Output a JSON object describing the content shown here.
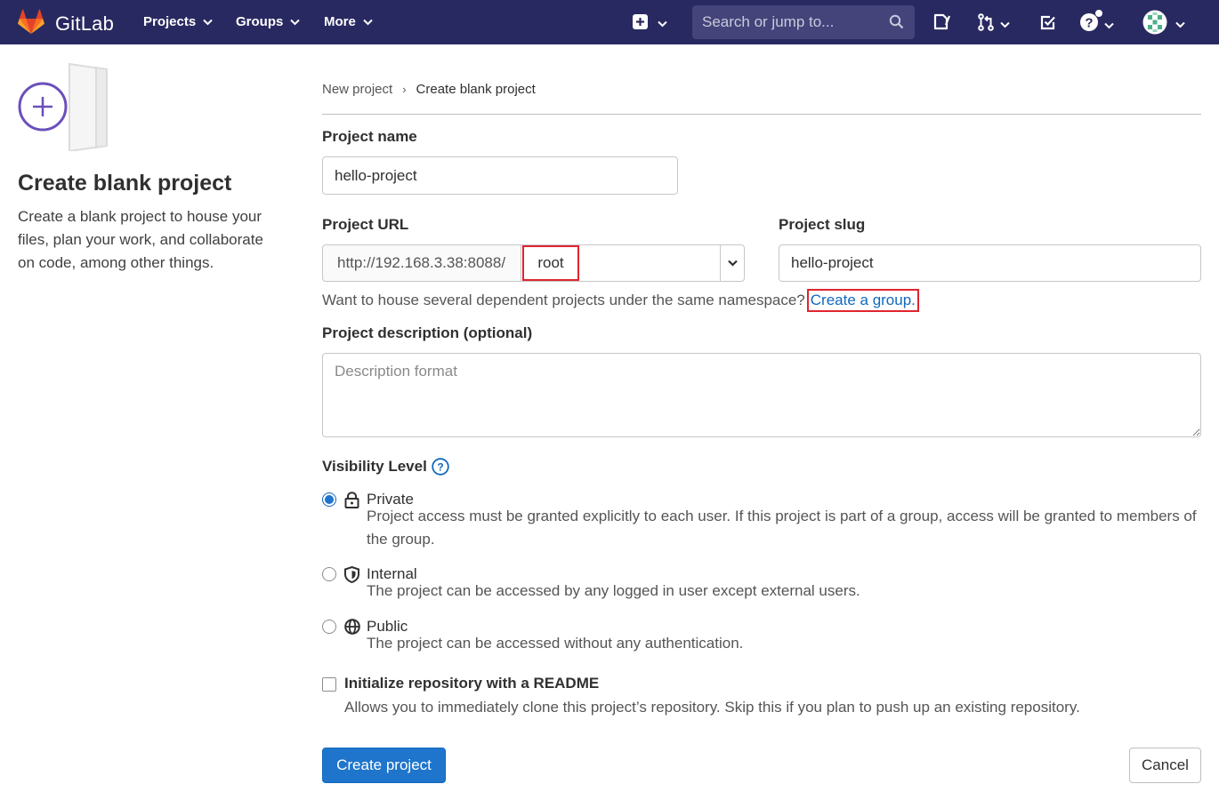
{
  "navbar": {
    "brand": "GitLab",
    "projects": "Projects",
    "groups": "Groups",
    "more": "More",
    "search_placeholder": "Search or jump to..."
  },
  "left": {
    "title": "Create blank project",
    "description": "Create a blank project to house your files, plan your work, and collaborate on code, among other things."
  },
  "breadcrumb": {
    "parent": "New project",
    "current": "Create blank project"
  },
  "form": {
    "project_name_label": "Project name",
    "project_name_value": "hello-project",
    "project_url_label": "Project URL",
    "project_url_prefix": "http://192.168.3.38:8088/",
    "namespace_value": "root",
    "project_slug_label": "Project slug",
    "project_slug_value": "hello-project",
    "group_hint": "Want to house several dependent projects under the same namespace?",
    "group_link": "Create a group.",
    "description_label": "Project description (optional)",
    "description_placeholder": "Description format"
  },
  "visibility": {
    "title": "Visibility Level",
    "options": [
      {
        "title": "Private",
        "description": "Project access must be granted explicitly to each user. If this project is part of a group, access will be granted to members of the group.",
        "icon": "lock-icon",
        "checked": true
      },
      {
        "title": "Internal",
        "description": "The project can be accessed by any logged in user except external users.",
        "icon": "shield-icon",
        "checked": false
      },
      {
        "title": "Public",
        "description": "The project can be accessed without any authentication.",
        "icon": "globe-icon",
        "checked": false
      }
    ]
  },
  "readme": {
    "label": "Initialize repository with a README",
    "description": "Allows you to immediately clone this project’s repository. Skip this if you plan to push up an existing repository.",
    "checked": false
  },
  "actions": {
    "create": "Create project",
    "cancel": "Cancel"
  },
  "colors": {
    "navbar": "#292961",
    "primary": "#1f75cb",
    "link": "#1068bf",
    "highlight": "#e0242e",
    "accent_purple": "#6b4fbb"
  }
}
